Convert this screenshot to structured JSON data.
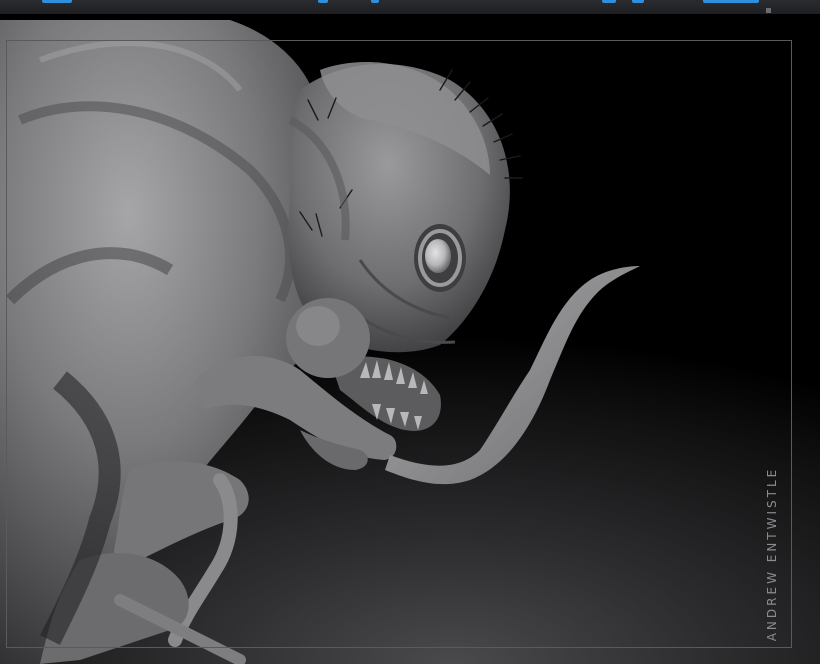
{
  "app": {
    "toolbar_buttons": [
      "button",
      "button",
      "button",
      "button",
      "button",
      "button"
    ]
  },
  "viewport": {
    "subject": "creature-sculpt",
    "signature": "ANDREW ENTWISTLE"
  },
  "colors": {
    "accent": "#2f8fdc",
    "background": "#000000",
    "sculpt": "#8a8a8c",
    "frame": "#5a5a5c"
  }
}
